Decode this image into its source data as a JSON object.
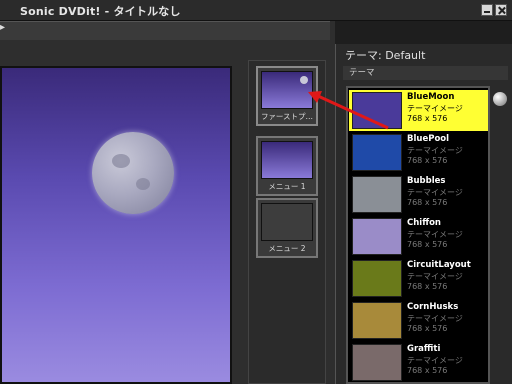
{
  "window": {
    "title": "Sonic DVDit! - タイトルなし"
  },
  "theme_panel": {
    "header": "テーマ: Default",
    "subheader": "テーマ",
    "items": [
      {
        "name": "BlueMoon",
        "desc": "テーマイメージ",
        "size": "768 x 576",
        "selected": true,
        "swatch": "#4a3a9a"
      },
      {
        "name": "BluePool",
        "desc": "テーマイメージ",
        "size": "768 x 576",
        "selected": false,
        "swatch": "#1f4aa8"
      },
      {
        "name": "Bubbles",
        "desc": "テーマイメージ",
        "size": "768 x 576",
        "selected": false,
        "swatch": "#8a8f96"
      },
      {
        "name": "Chiffon",
        "desc": "テーマイメージ",
        "size": "768 x 576",
        "selected": false,
        "swatch": "#9a8cc8"
      },
      {
        "name": "CircuitLayout",
        "desc": "テーマイメージ",
        "size": "768 x 576",
        "selected": false,
        "swatch": "#6a7a1a"
      },
      {
        "name": "CornHusks",
        "desc": "テーマイメージ",
        "size": "768 x 576",
        "selected": false,
        "swatch": "#a88a3a"
      },
      {
        "name": "Graffiti",
        "desc": "テーマイメージ",
        "size": "768 x 576",
        "selected": false,
        "swatch": "#7a6a6a"
      }
    ]
  },
  "menus": [
    {
      "label": "ファーストプ…"
    },
    {
      "label": "メニュー 1"
    },
    {
      "label": "メニュー 2"
    }
  ],
  "colors": {
    "selection": "#ffff33",
    "arrow": "#e01818",
    "background": "#1e1e1e"
  }
}
